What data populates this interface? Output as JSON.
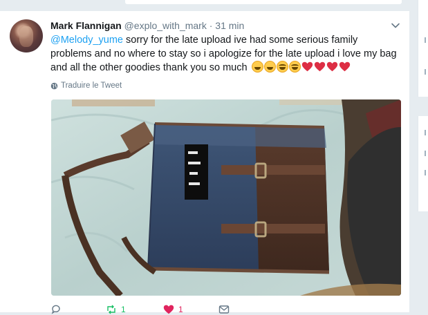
{
  "tweet": {
    "author_name": "Mark Flannigan",
    "author_handle": "@explo_with_mark",
    "separator": "·",
    "time": "31 min",
    "mention": "@Melody_yume",
    "text": "sorry for the late upload ive had some serious family problems and no where to stay so i apologize for the late upload i love my bag and all the other goodies thank you so much",
    "emoji_icons": [
      "grinning-face-icon",
      "grinning-face-icon",
      "smiling-blush-face-icon",
      "smiling-blush-face-icon",
      "red-heart-icon",
      "red-heart-icon",
      "red-heart-icon",
      "red-heart-icon"
    ],
    "translate_label": "Traduire le Tweet",
    "retweet_count": "1",
    "like_count": "1"
  },
  "colors": {
    "accent": "#1da1f2",
    "text": "#14171a",
    "muted": "#657786",
    "retweet": "#17bf63",
    "like": "#e0245e",
    "background": "#e6ecf0"
  }
}
